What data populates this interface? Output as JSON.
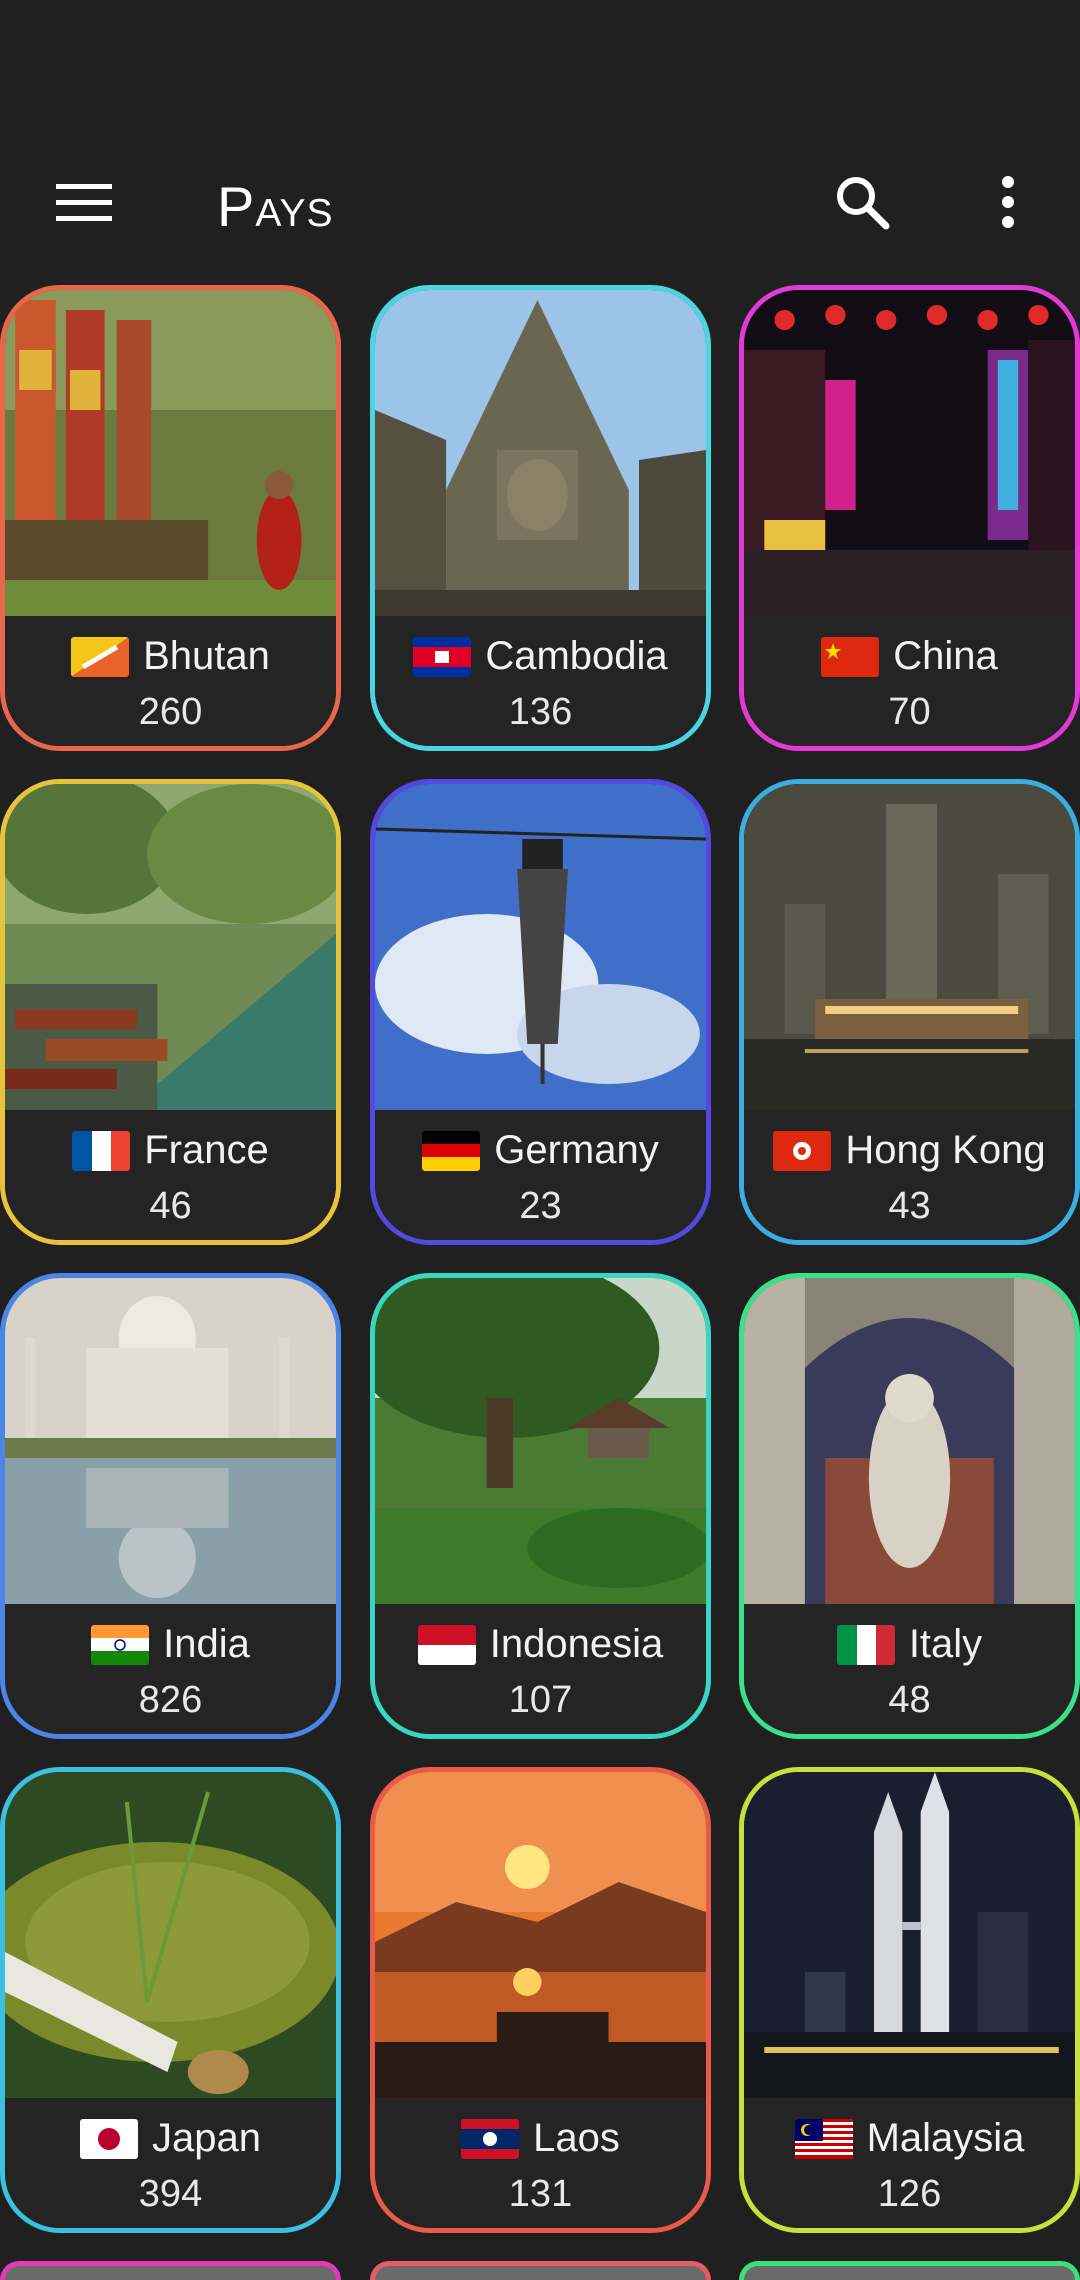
{
  "app_bar": {
    "title": "Pays",
    "menu_icon": "hamburger-menu-icon",
    "search_icon": "search-icon",
    "more_icon": "more-vertical-icon"
  },
  "countries": [
    {
      "name": "Bhutan",
      "count": "260",
      "border": "#e8664a",
      "flag": "bhutan-flag-icon"
    },
    {
      "name": "Cambodia",
      "count": "136",
      "border": "#49d6e0",
      "flag": "cambodia-flag-icon"
    },
    {
      "name": "China",
      "count": "70",
      "border": "#e23ad6",
      "flag": "china-flag-icon"
    },
    {
      "name": "France",
      "count": "46",
      "border": "#e8c43c",
      "flag": "france-flag-icon"
    },
    {
      "name": "Germany",
      "count": "23",
      "border": "#5548e0",
      "flag": "germany-flag-icon"
    },
    {
      "name": "Hong Kong",
      "count": "43",
      "border": "#3aaee0",
      "flag": "hong-kong-flag-icon"
    },
    {
      "name": "India",
      "count": "826",
      "border": "#4a86e8",
      "flag": "india-flag-icon"
    },
    {
      "name": "Indonesia",
      "count": "107",
      "border": "#3ad6c4",
      "flag": "indonesia-flag-icon"
    },
    {
      "name": "Italy",
      "count": "48",
      "border": "#3ae08c",
      "flag": "italy-flag-icon"
    },
    {
      "name": "Japan",
      "count": "394",
      "border": "#3ac0e0",
      "flag": "japan-flag-icon"
    },
    {
      "name": "Laos",
      "count": "131",
      "border": "#e85a4a",
      "flag": "laos-flag-icon"
    },
    {
      "name": "Malaysia",
      "count": "126",
      "border": "#c8e03a",
      "flag": "malaysia-flag-icon"
    }
  ],
  "partial_row_borders": [
    "#e03ab8",
    "#e85a6a",
    "#3ae07a"
  ],
  "colors": {
    "background": "#202020",
    "caption_background": "#242424",
    "text": "#f2f2f2"
  }
}
